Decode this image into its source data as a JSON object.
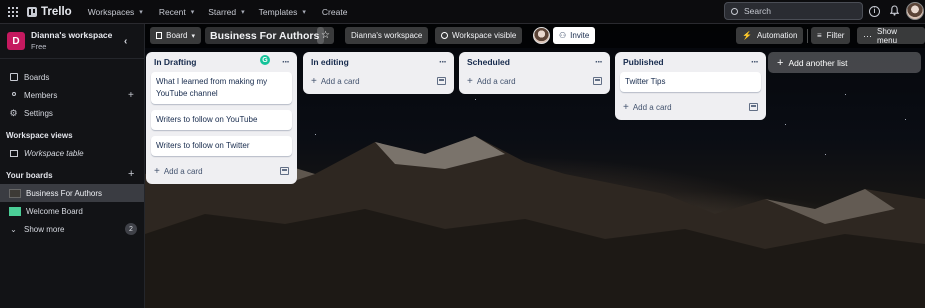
{
  "topbar": {
    "logo": "Trello",
    "menus": [
      "Workspaces",
      "Recent",
      "Starred",
      "Templates"
    ],
    "create_label": "Create",
    "search_placeholder": "Search"
  },
  "sidebar": {
    "workspace_initial": "D",
    "workspace_name": "Dianna's workspace",
    "workspace_plan": "Free",
    "nav": [
      {
        "label": "Boards",
        "icon": "trello-board-icon"
      },
      {
        "label": "Members",
        "icon": "members-icon"
      },
      {
        "label": "Settings",
        "icon": "gear-icon"
      }
    ],
    "views_heading": "Workspace views",
    "views": [
      {
        "label": "Workspace table",
        "icon": "table-icon"
      }
    ],
    "your_boards_heading": "Your boards",
    "boards": [
      {
        "label": "Business For Authors",
        "color": "#3d3a36"
      },
      {
        "label": "Welcome Board",
        "color": "#4bce97"
      }
    ],
    "show_more_label": "Show more",
    "show_more_count": "2"
  },
  "board": {
    "view_label": "Board",
    "title": "Business For Authors",
    "workspace_label": "Dianna's workspace",
    "visibility_label": "Workspace visible",
    "invite_label": "Invite",
    "automation_label": "Automation",
    "filter_label": "Filter",
    "show_menu_label": "Show menu",
    "add_list_label": "Add another list",
    "add_card_label": "Add a card",
    "lists": [
      {
        "title": "In Drafting",
        "cards": [
          "What I learned from making my YouTube channel",
          "Writers to follow on YouTube",
          "Writers to follow on Twitter"
        ]
      },
      {
        "title": "In editing",
        "cards": []
      },
      {
        "title": "Scheduled",
        "cards": []
      },
      {
        "title": "Published",
        "cards": [
          "Twitter Tips"
        ]
      }
    ]
  },
  "colors": {
    "accent_workspace": "#c5195f",
    "grammarly": "#15c39a"
  }
}
